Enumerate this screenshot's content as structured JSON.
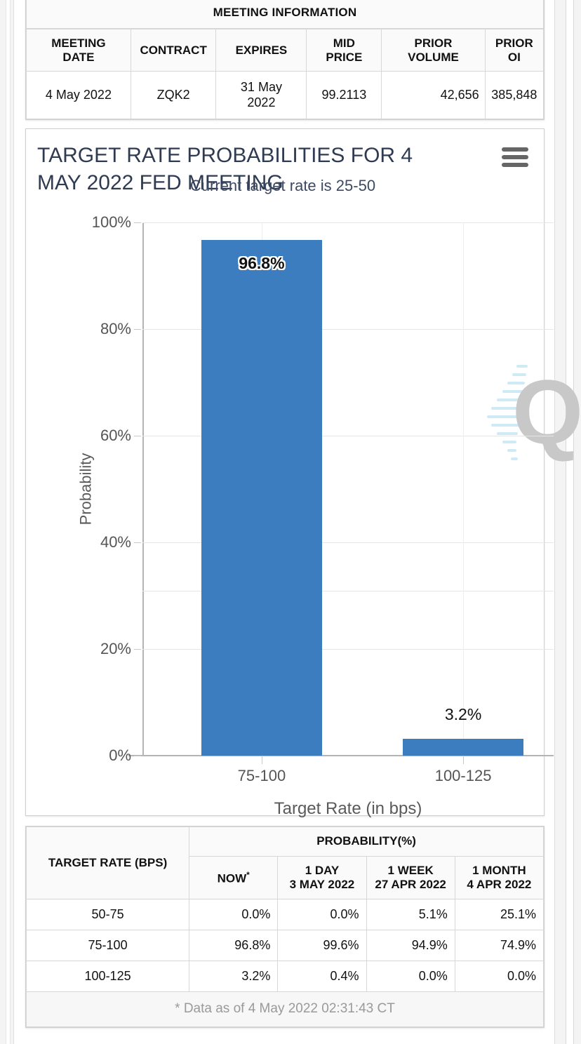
{
  "meeting_info": {
    "title": "MEETING INFORMATION",
    "columns": [
      "MEETING DATE",
      "CONTRACT",
      "EXPIRES",
      "MID PRICE",
      "PRIOR VOLUME",
      "PRIOR OI"
    ],
    "columns_wrapped": [
      [
        "MEETING",
        "DATE"
      ],
      [
        "CONTRACT",
        ""
      ],
      [
        "EXPIRES",
        ""
      ],
      [
        "MID",
        "PRICE"
      ],
      [
        "PRIOR",
        "VOLUME"
      ],
      [
        "PRIOR",
        "OI"
      ]
    ],
    "row": {
      "meeting_date": "4 May 2022",
      "contract": "ZQK2",
      "expires_line1": "31 May",
      "expires_line2": "2022",
      "mid_price": "99.2113",
      "prior_volume": "42,656",
      "prior_oi": "385,848"
    }
  },
  "chart": {
    "title_line1": "TARGET RATE PROBABILITIES FOR 4",
    "title_line2": "MAY 2022 FED MEETING",
    "subtitle": "Current target rate is 25-50",
    "menu_icon": "hamburger-menu-icon",
    "watermark_letter": "Q",
    "accent_color": "#3c7dbf",
    "title_color": "#2f3b52"
  },
  "chart_data": {
    "type": "bar",
    "title": "TARGET RATE PROBABILITIES FOR 4 MAY 2022 FED MEETING",
    "subtitle": "Current target rate is 25-50",
    "xlabel": "Target Rate (in bps)",
    "ylabel": "Probability",
    "categories": [
      "75-100",
      "100-125"
    ],
    "values": [
      96.8,
      3.2
    ],
    "value_labels": [
      "96.8%",
      "3.2%"
    ],
    "ylim": [
      0,
      100
    ],
    "yticks": [
      0,
      20,
      40,
      60,
      80,
      100
    ],
    "ytick_labels": [
      "0%",
      "20%",
      "40%",
      "60%",
      "80%",
      "100%"
    ],
    "grid": true,
    "legend": "none",
    "series": [
      {
        "name": "Probability",
        "values": [
          96.8,
          3.2
        ]
      }
    ]
  },
  "probability_table": {
    "rate_header": "TARGET RATE (BPS)",
    "prob_header": "PROBABILITY(%)",
    "columns": [
      {
        "line1": "NOW",
        "line2": "",
        "star": "*"
      },
      {
        "line1": "1 DAY",
        "line2": "3 MAY 2022",
        "star": ""
      },
      {
        "line1": "1 WEEK",
        "line2": "27 APR 2022",
        "star": ""
      },
      {
        "line1": "1 MONTH",
        "line2": "4 APR 2022",
        "star": ""
      }
    ],
    "rows": [
      {
        "rate": "50-75",
        "now": "0.0%",
        "day": "0.0%",
        "week": "5.1%",
        "month": "25.1%"
      },
      {
        "rate": "75-100",
        "now": "96.8%",
        "day": "99.6%",
        "week": "94.9%",
        "month": "74.9%"
      },
      {
        "rate": "100-125",
        "now": "3.2%",
        "day": "0.4%",
        "week": "0.0%",
        "month": "0.0%"
      }
    ],
    "footer": "* Data as of 4 May 2022 02:31:43 CT",
    "highlight_color": "#f4f4c8"
  }
}
